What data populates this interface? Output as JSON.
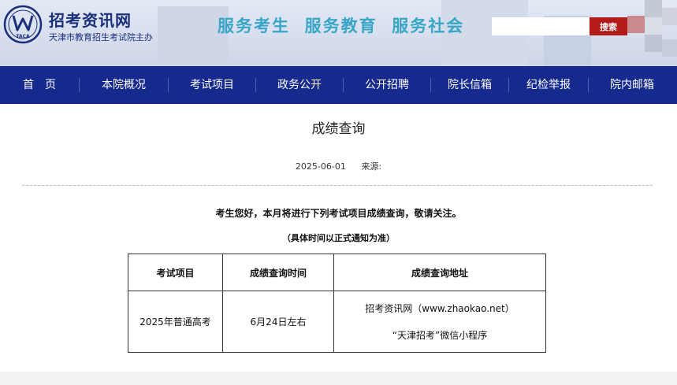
{
  "header": {
    "site_name": "招考资讯网",
    "site_sub": "天津市教育招生考试院主办",
    "logo_text": "TACA",
    "slogan": "服务考生  服务教育  服务社会",
    "search_placeholder": "",
    "search_label": "搜索"
  },
  "nav": {
    "items": [
      "首　页",
      "本院概况",
      "考试项目",
      "政务公开",
      "公开招聘",
      "院长信箱",
      "纪检举报",
      "院内邮箱"
    ]
  },
  "article": {
    "title": "成绩查询",
    "date": "2025-06-01",
    "source_label": "来源:",
    "lead": "考生您好，本月将进行下列考试项目成绩查询，敬请关注。",
    "note": "（具体时间以正式通知为准）",
    "table": {
      "headers": [
        "考试项目",
        "成绩查询时间",
        "成绩查询地址"
      ],
      "rows": [
        {
          "item": "2025年普通高考",
          "time": "6月24日左右",
          "address_lines": [
            "招考资讯网（www.zhaokao.net）",
            "“天津招考”微信小程序"
          ]
        }
      ]
    }
  },
  "colors": {
    "nav_bg": "#152a8c",
    "brand_blue": "#1a2f7a",
    "slogan": "#38a6c7",
    "search_btn": "#b31a1a"
  }
}
